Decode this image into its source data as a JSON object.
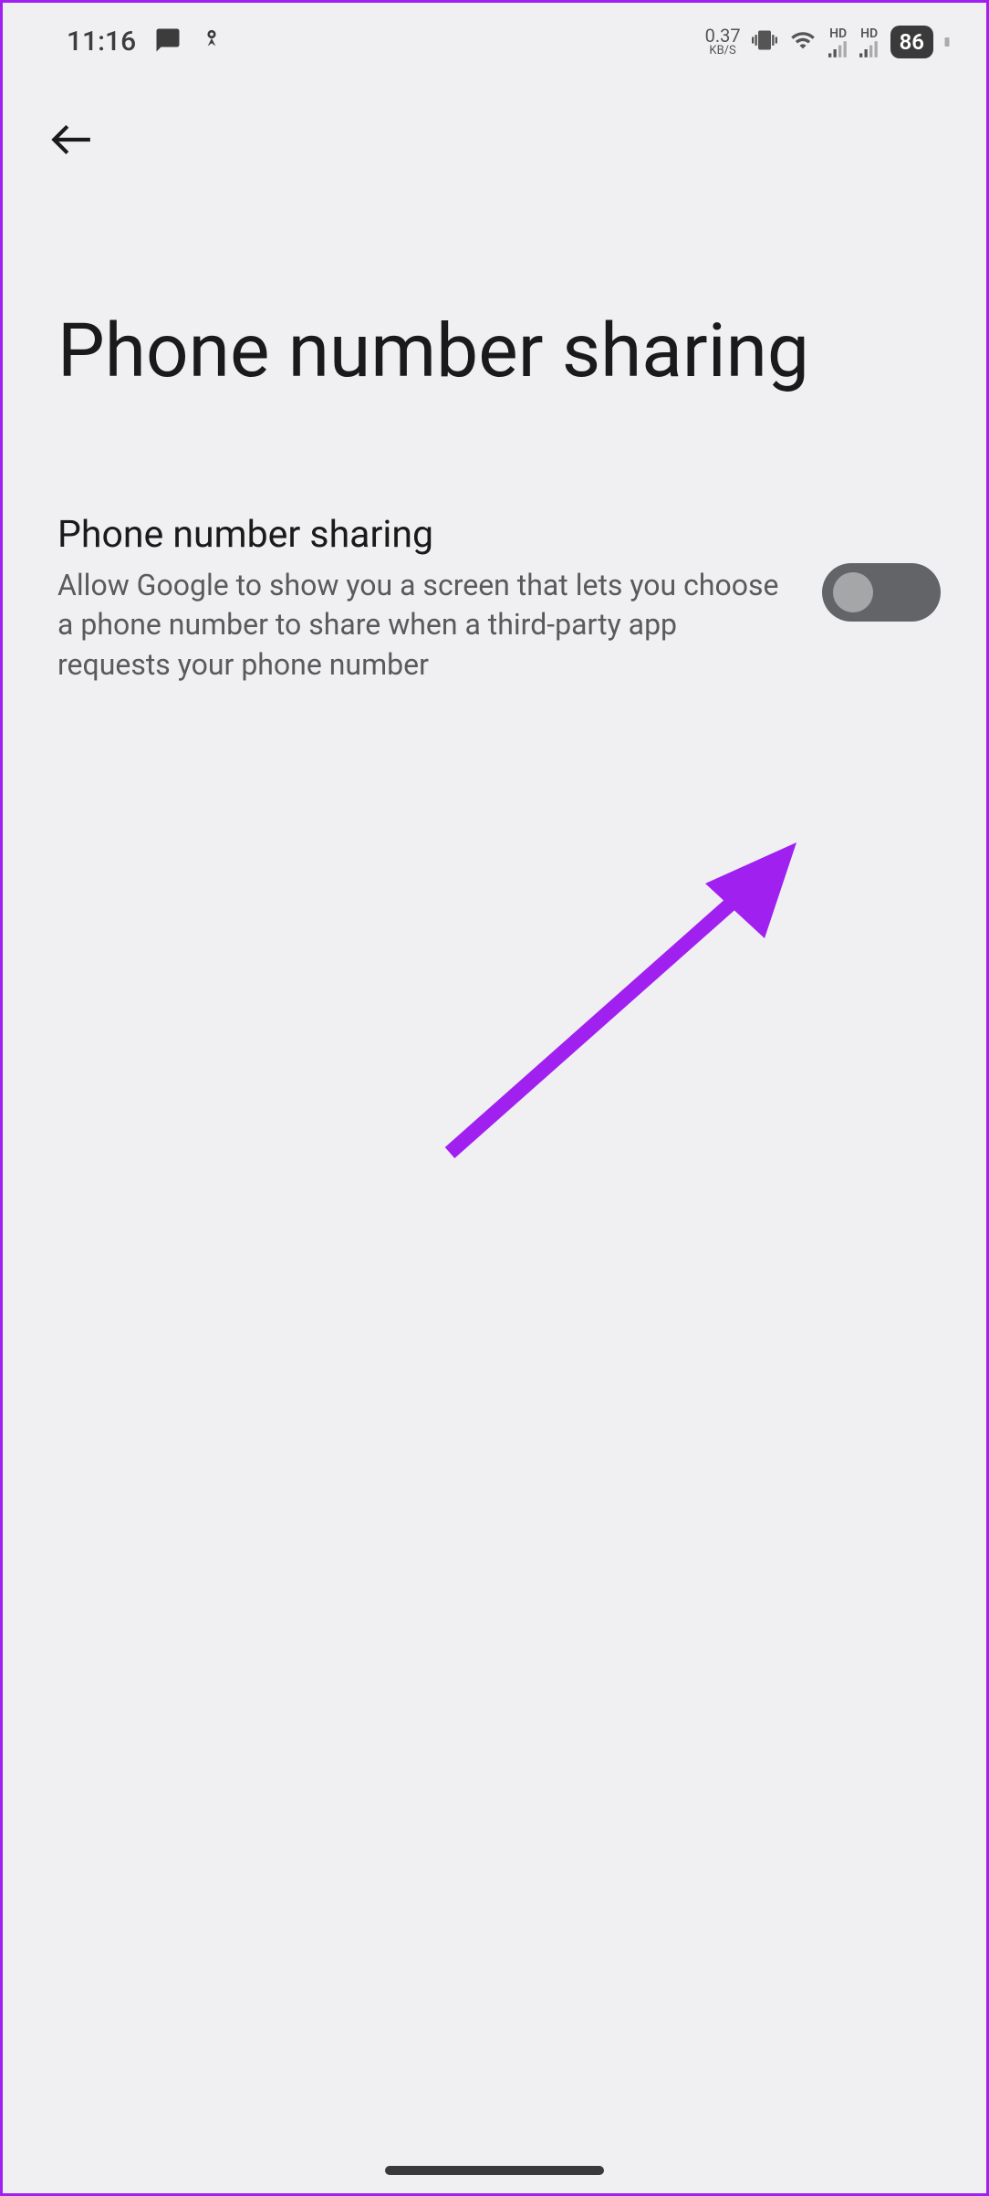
{
  "status_bar": {
    "time": "11:16",
    "data_speed_value": "0.37",
    "data_speed_unit": "KB/S",
    "battery_percent": "86",
    "hd_label_1": "HD",
    "hd_label_2": "HD"
  },
  "page": {
    "title": "Phone number sharing"
  },
  "setting": {
    "title": "Phone number sharing",
    "description": "Allow Google to show you a screen that lets you choose a phone number to share when a third-party app requests your phone number",
    "toggle_state": "off"
  },
  "annotation": {
    "arrow_color": "#a020f0"
  }
}
